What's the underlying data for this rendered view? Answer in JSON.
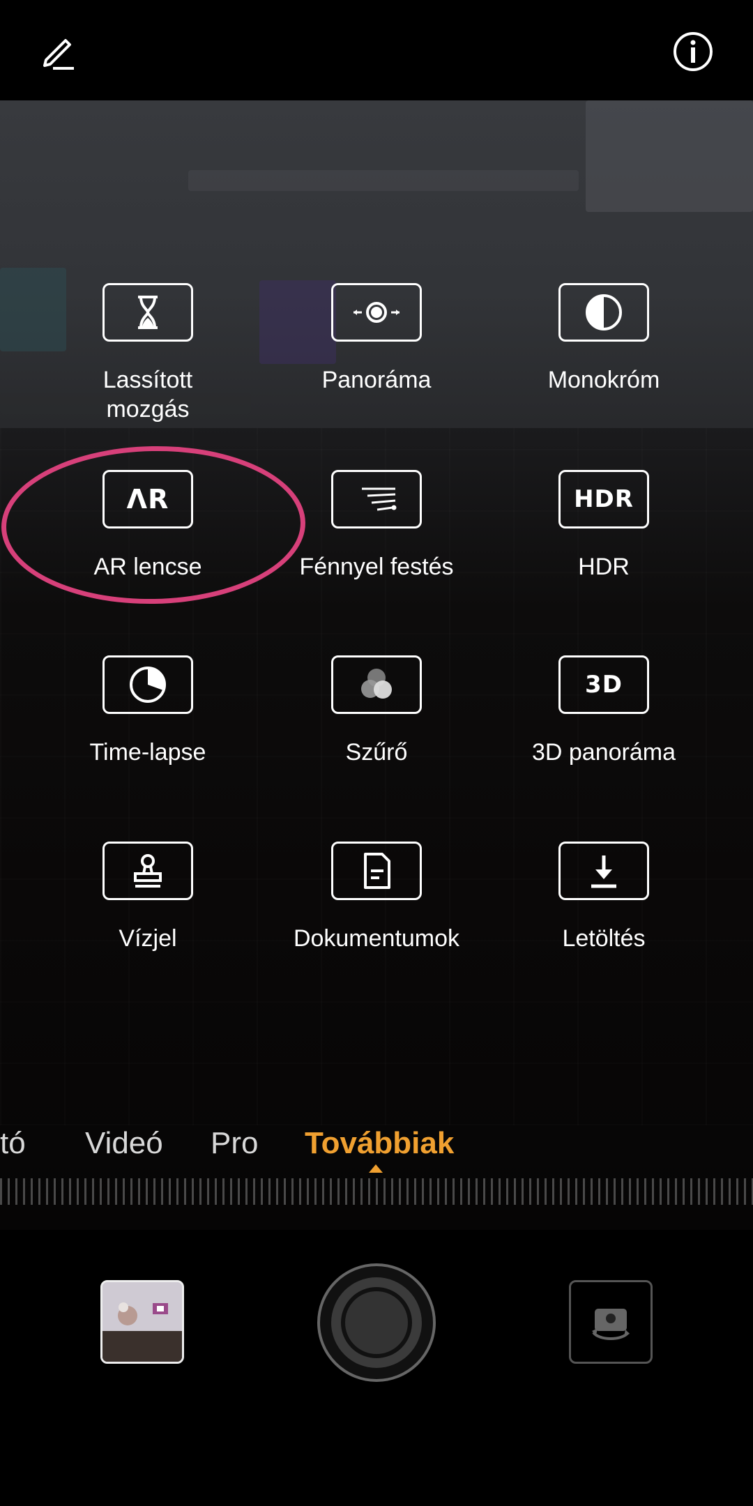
{
  "header": {
    "edit_icon": "pencil-edit-icon",
    "info_icon": "info-icon"
  },
  "modes": [
    {
      "id": "slow-motion",
      "label": "Lassított\nmozgás",
      "icon": "hourglass-icon"
    },
    {
      "id": "panorama",
      "label": "Panoráma",
      "icon": "panorama-icon"
    },
    {
      "id": "monochrome",
      "label": "Monokróm",
      "icon": "half-circle-icon"
    },
    {
      "id": "ar-lens",
      "label": "AR lencse",
      "icon": "ar-icon",
      "icon_text": "ΛR"
    },
    {
      "id": "light-painting",
      "label": "Fénnyel festés",
      "icon": "light-streaks-icon"
    },
    {
      "id": "hdr",
      "label": "HDR",
      "icon": "hdr-icon",
      "icon_text": "HDR"
    },
    {
      "id": "time-lapse",
      "label": "Time-lapse",
      "icon": "timelapse-icon"
    },
    {
      "id": "filter",
      "label": "Szűrő",
      "icon": "filter-icon"
    },
    {
      "id": "3d-panorama",
      "label": "3D panoráma",
      "icon": "3d-icon",
      "icon_text": "3D"
    },
    {
      "id": "watermark",
      "label": "Vízjel",
      "icon": "stamp-icon"
    },
    {
      "id": "documents",
      "label": "Dokumentumok",
      "icon": "document-icon"
    },
    {
      "id": "download",
      "label": "Letöltés",
      "icon": "download-icon"
    }
  ],
  "highlight_color": "#d7407a",
  "tabs": [
    {
      "label": "tó",
      "active": false
    },
    {
      "label": "Videó",
      "active": false
    },
    {
      "label": "Pro",
      "active": false
    },
    {
      "label": "Továbbiak",
      "active": true
    }
  ],
  "accent_color": "#f0a030",
  "bottom": {
    "gallery": "gallery-thumbnail",
    "shutter": "shutter-button",
    "switch": "switch-camera-icon"
  }
}
